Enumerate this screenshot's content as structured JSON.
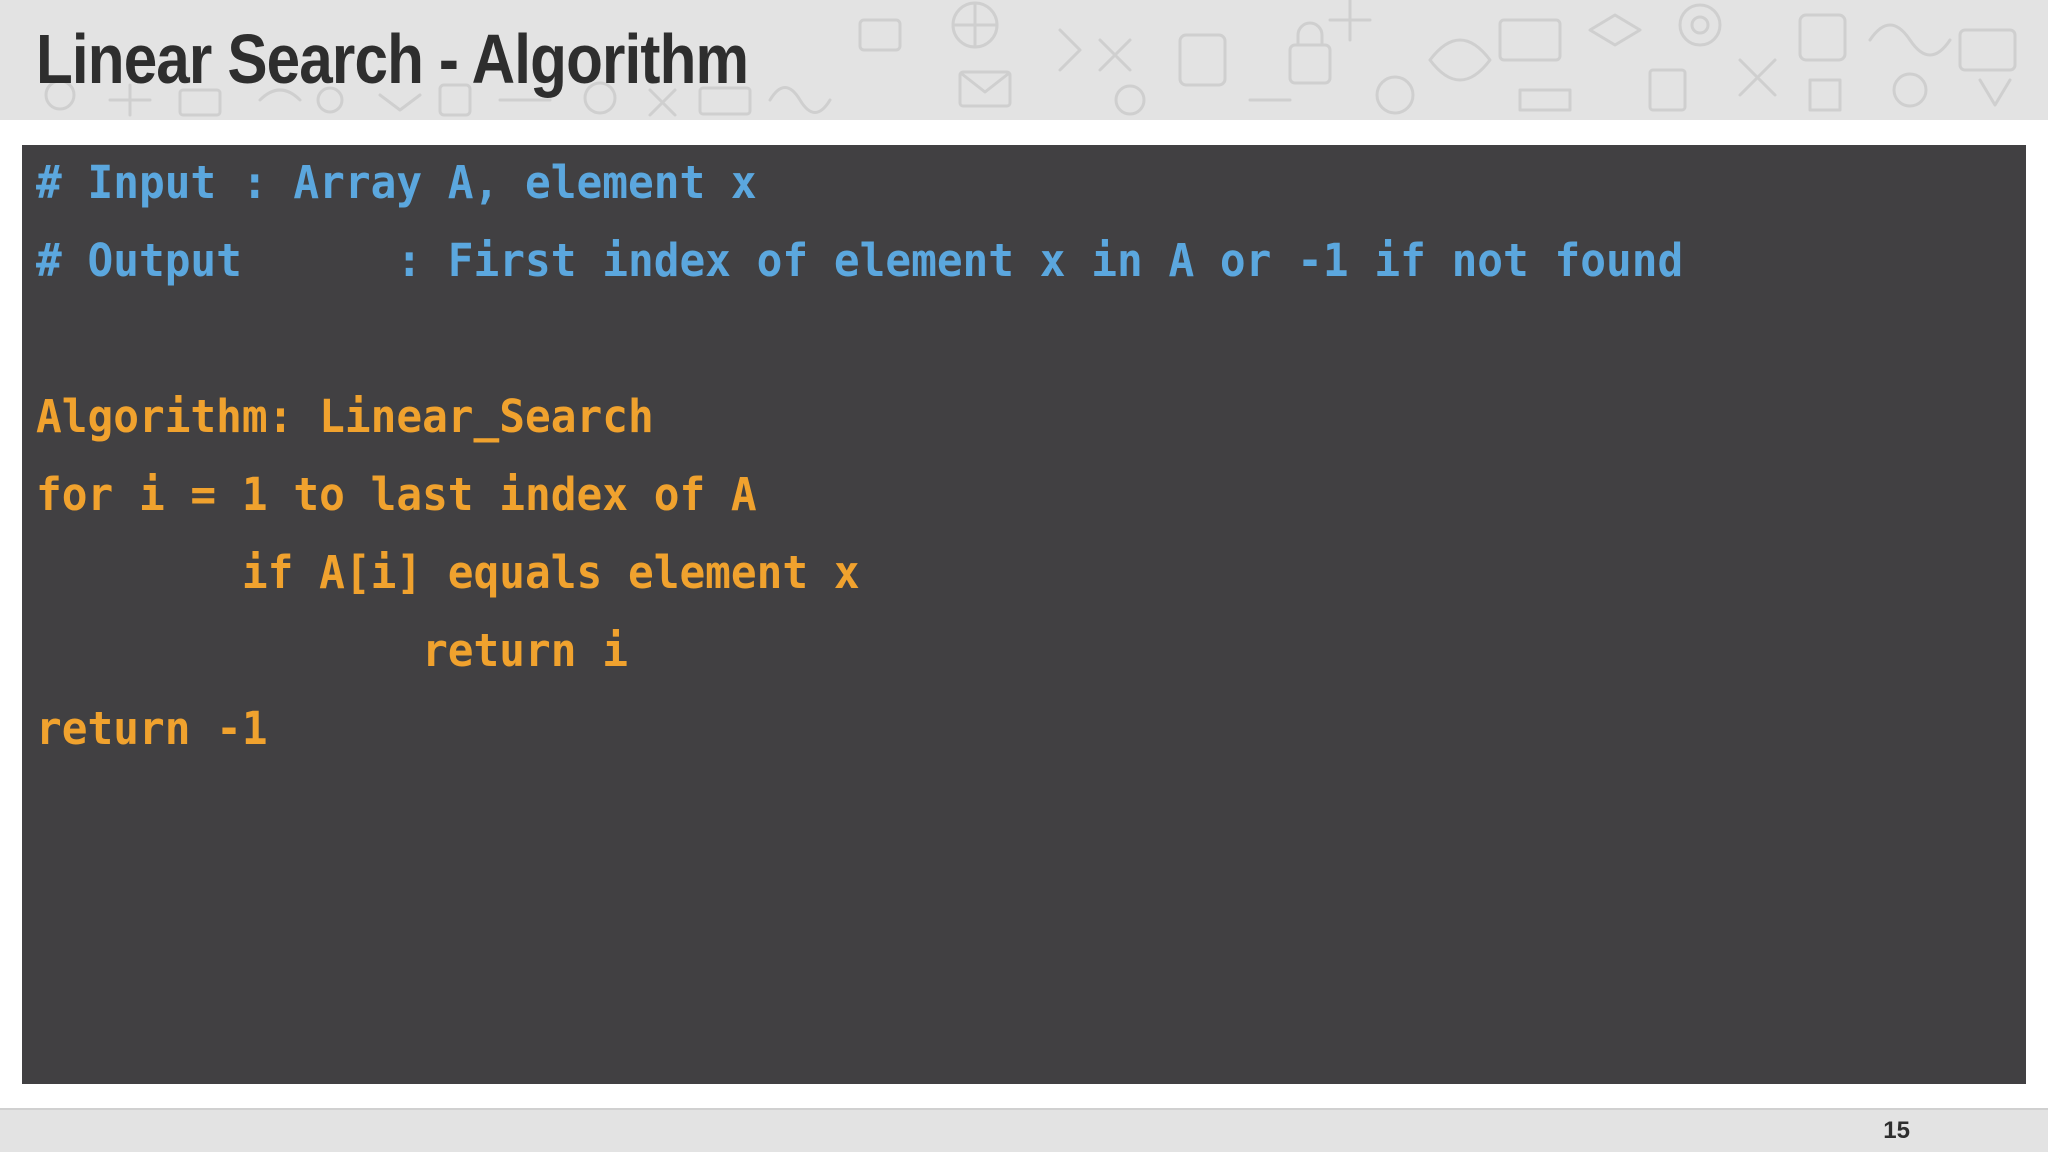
{
  "slide": {
    "title": "Linear Search - Algorithm",
    "page_number": "15"
  },
  "code": {
    "lines": [
      {
        "text": "# Input : Array A, element x",
        "role": "comment"
      },
      {
        "text": "# Output      : First index of element x in A or -1 if not found",
        "role": "comment"
      },
      {
        "text": "",
        "role": "blank"
      },
      {
        "text": "Algorithm: Linear_Search",
        "role": "code"
      },
      {
        "text": "for i = 1 to last index of A",
        "role": "code"
      },
      {
        "text": "        if A[i] equals element x",
        "role": "code"
      },
      {
        "text": "               return i",
        "role": "code"
      },
      {
        "text": "return -1",
        "role": "code"
      }
    ]
  },
  "colors": {
    "comment": "#5ba7de",
    "code": "#f0a22e",
    "panel_background": "#414042",
    "header_background": "#e3e3e3",
    "title": "#2e2e2e"
  }
}
